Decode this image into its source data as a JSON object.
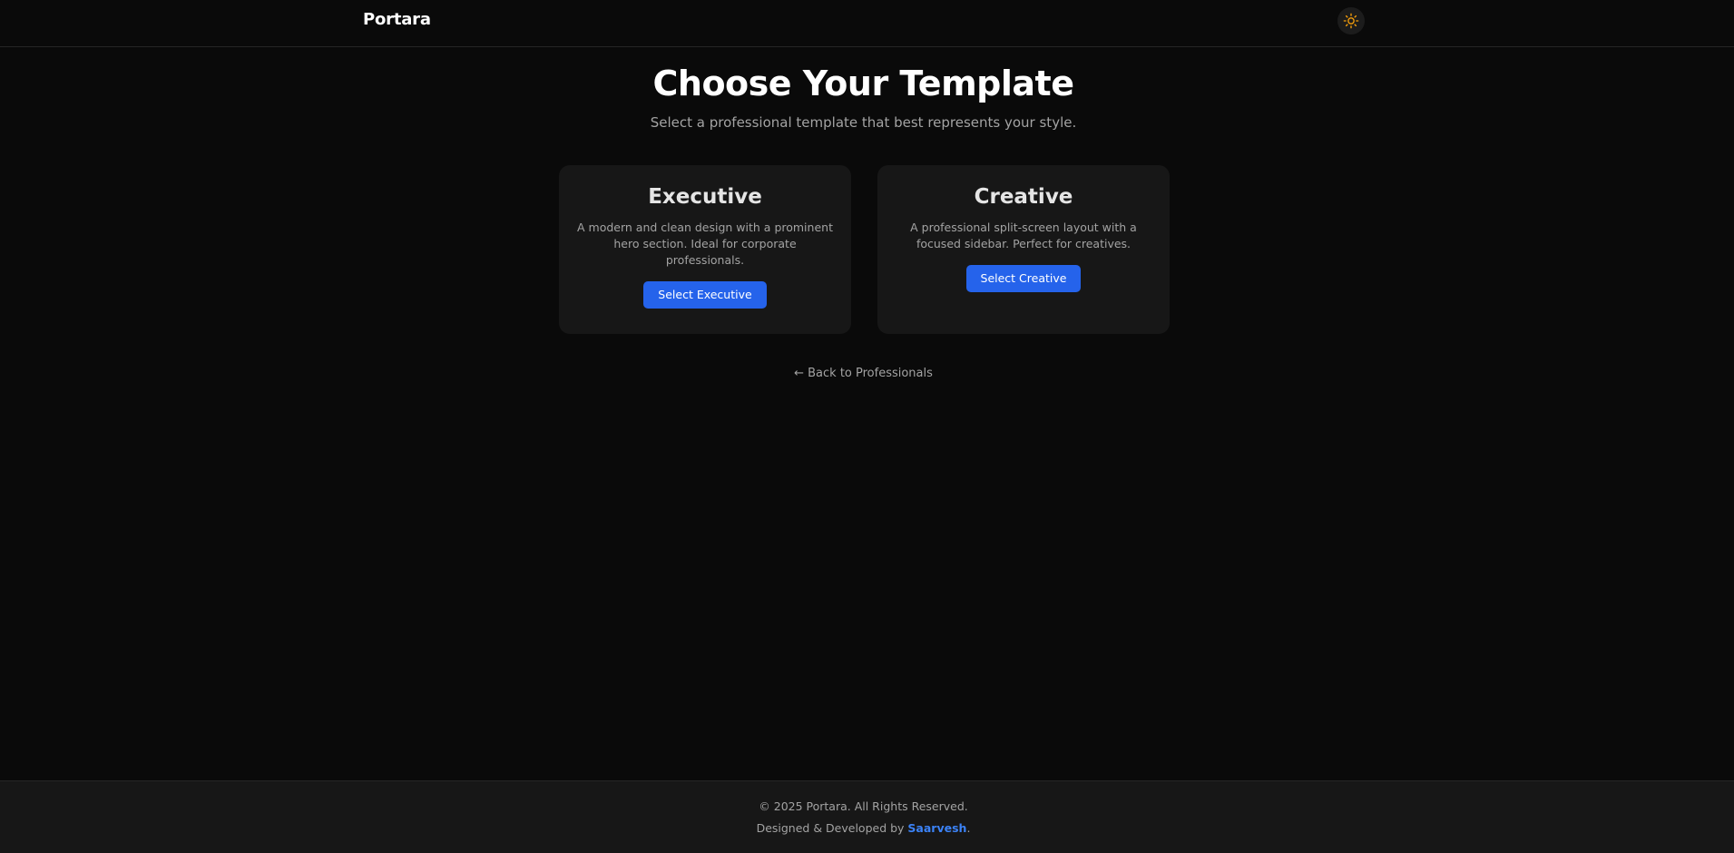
{
  "header": {
    "brand": "Portara",
    "theme_toggle_icon": "sun-icon",
    "theme_icon_color": "#f59e0b"
  },
  "hero": {
    "title": "Choose Your Template",
    "subtitle": "Select a professional template that best represents your style."
  },
  "templates": [
    {
      "title": "Executive",
      "description": "A modern and clean design with a prominent hero section. Ideal for corporate professionals.",
      "button_label": "Select Executive"
    },
    {
      "title": "Creative",
      "description": "A professional split-screen layout with a focused sidebar. Perfect for creatives.",
      "button_label": "Select Creative"
    }
  ],
  "back_link": {
    "arrow": "←",
    "label": "Back to Professionals"
  },
  "footer": {
    "copyright": "© 2025 Portara. All Rights Reserved.",
    "credit_prefix": "Designed & Developed by",
    "credit_name": "Saarvesh",
    "credit_suffix": "."
  },
  "colors": {
    "accent": "#2563eb",
    "link": "#3b82f6",
    "background": "#0a0a0a",
    "card": "#171717"
  }
}
